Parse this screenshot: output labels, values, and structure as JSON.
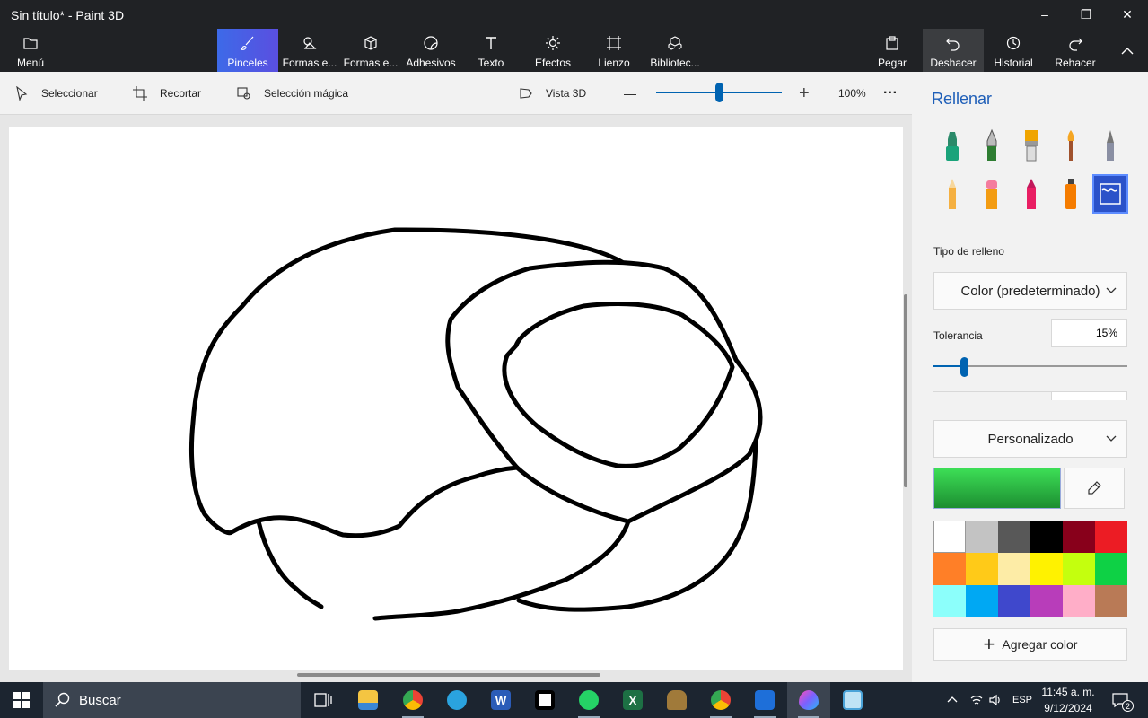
{
  "window": {
    "title": "Sin título* - Paint 3D",
    "minimize": "–",
    "restore": "❐",
    "close": "✕"
  },
  "ribbon": {
    "menu": "Menú",
    "tabs": [
      "Pinceles",
      "Formas e...",
      "Formas e...",
      "Adhesivos",
      "Texto",
      "Efectos",
      "Lienzo",
      "Bibliotec..."
    ],
    "right": [
      "Pegar",
      "Deshacer",
      "Historial",
      "Rehacer"
    ]
  },
  "toolbar": {
    "select": "Seleccionar",
    "crop": "Recortar",
    "magic_select": "Selección mágica",
    "view3d": "Vista 3D",
    "zoom_minus": "—",
    "zoom_plus": "+",
    "zoom_level": "100%",
    "zoom_fraction": 0.5,
    "more": "···"
  },
  "panel": {
    "title": "Rellenar",
    "fill_type_label": "Tipo de relleno",
    "fill_type_value": "Color (predeterminado)",
    "tolerance_label": "Tolerancia",
    "tolerance_value": "15%",
    "tolerance_fraction": 0.15,
    "color_mode": "Personalizado",
    "current_color": "#2ecc45",
    "palette": [
      "#ffffff",
      "#c3c3c3",
      "#585858",
      "#000000",
      "#88001b",
      "#ec1c24",
      "#ff7f27",
      "#ffca18",
      "#fdeca6",
      "#fff200",
      "#c4ff0e",
      "#0ed145",
      "#8cfffb",
      "#00a8f3",
      "#3f48cc",
      "#b83dba",
      "#ffaec8",
      "#b97a56"
    ],
    "add_color": "Agregar color",
    "brushes": [
      "marker-icon",
      "calligraphy-pen-icon",
      "oil-brush-icon",
      "watercolor-icon",
      "pixel-pen-icon",
      "pencil-icon",
      "eraser-icon",
      "crayon-icon",
      "spray-can-icon",
      "fill-icon"
    ]
  },
  "taskbar": {
    "search_placeholder": "Buscar",
    "apps": [
      "task-view-icon",
      "file-explorer-icon",
      "chrome-icon",
      "telegram-icon",
      "word-icon",
      "capcut-icon",
      "whatsapp-icon",
      "excel-icon",
      "app-helmet-icon",
      "chrome-icon",
      "photos-icon",
      "paint-3d-icon",
      "notepad-icon"
    ],
    "language": "ESP",
    "time": "11:45 a. m.",
    "date": "9/12/2024",
    "notifications": "2"
  },
  "colors": {
    "accent": "#0063b1",
    "titlebar": "#202225",
    "active_tab": "#3d6ae8"
  }
}
